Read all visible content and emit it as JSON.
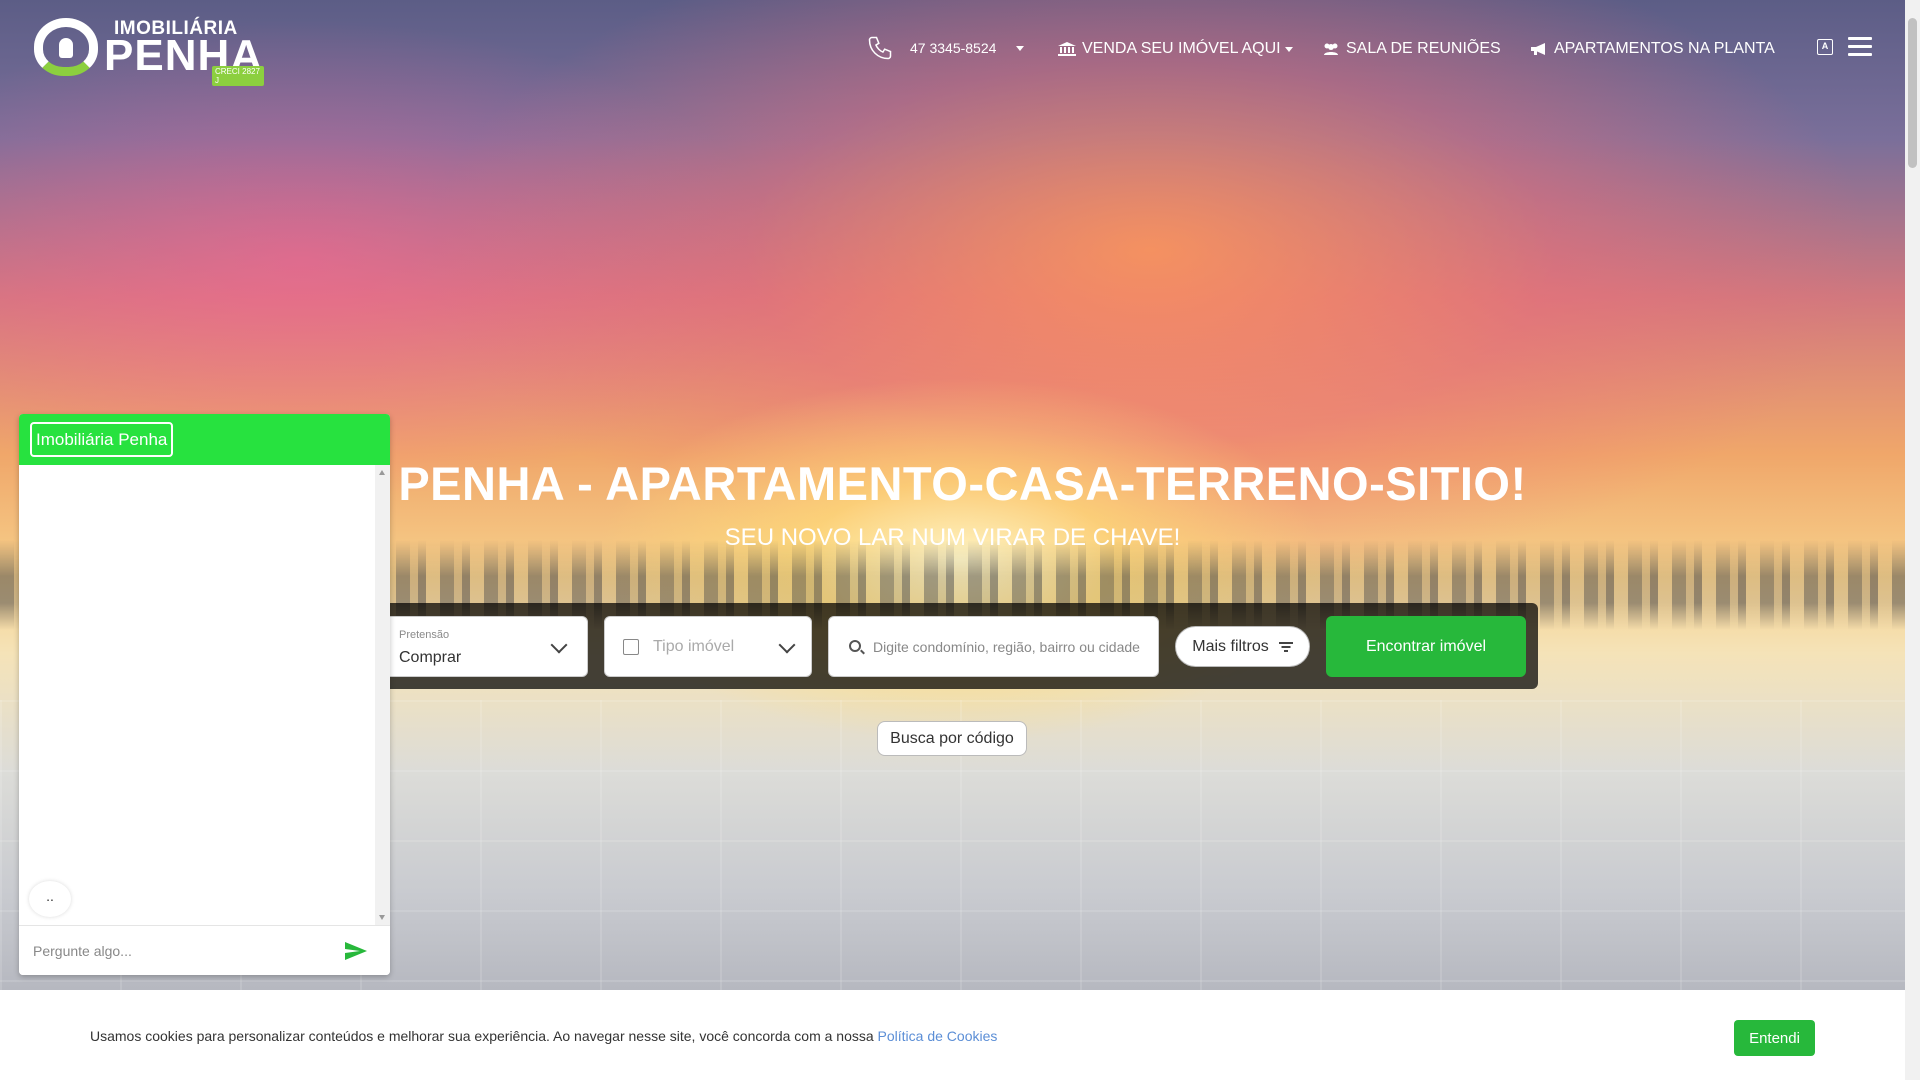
{
  "brand": {
    "line1": "IMOBILIÁRIA",
    "line2": "PENHA",
    "creci": "CRECI 2827 J"
  },
  "header": {
    "phone": "47 3345-8524",
    "nav": {
      "venda": "VENDA SEU IMÓVEL AQUI",
      "sala": "SALA DE REUNIÕES",
      "apto": "APARTAMENTOS NA PLANTA"
    },
    "icons": [
      "phone-icon",
      "bank-icon",
      "users-icon",
      "megaphone-icon",
      "translate-icon",
      "hamburger-icon"
    ]
  },
  "hero": {
    "title": "PENHA - APARTAMENTO-CASA-TERRENO-SITIO!",
    "subtitle": "SEU NOVO LAR NUM VIRAR DE CHAVE!"
  },
  "search": {
    "pretensao_label": "Pretensão",
    "pretensao_value": "Comprar",
    "tipo_placeholder": "Tipo imóvel",
    "busca_placeholder": "Digite condomínio, região, bairro ou cidade",
    "mais_filtros": "Mais filtros",
    "submit": "Encontrar imóvel",
    "busca_codigo": "Busca por código"
  },
  "chat": {
    "title": "Imobiliária Penha",
    "bubble": "..",
    "input_placeholder": "Pergunte algo..."
  },
  "cookie": {
    "text": "Usamos cookies para personalizar conteúdos e melhorar sua experiência. Ao navegar nesse site, você concorda com a nossa ",
    "link": "Política de Cookies",
    "button": "Entendi"
  },
  "colors": {
    "accent_green": "#27b83b",
    "chat_header": "#27e23f",
    "logo_green": "#8ccf3f"
  }
}
